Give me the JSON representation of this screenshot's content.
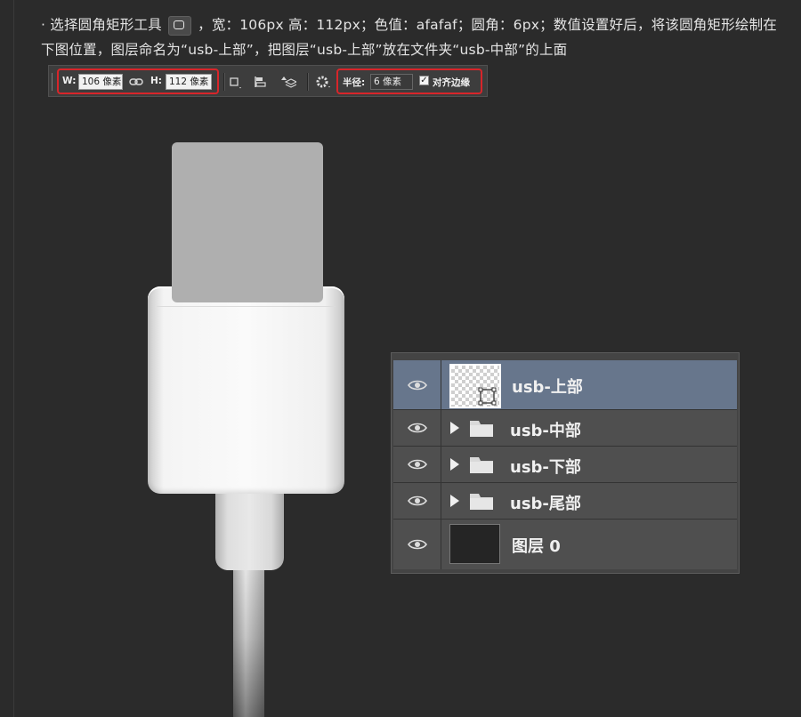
{
  "instruction": {
    "line1_a": "· 选择圆角矩形工具",
    "line1_b": "，宽：106px 高：112px；色值：afafaf；圆角：6px；数值设置好后，将该圆角矩形绘制在",
    "line2": "下图位置，图层命名为“usb-上部”，把图层“usb-上部”放在文件夹“usb-中部”的上面"
  },
  "toolbar": {
    "w_label": "W:",
    "w_value": "106 像素",
    "h_label": "H:",
    "h_value": "112 像素",
    "radius_label": "半径:",
    "radius_value": "6 像素",
    "align_edges_label": "对齐边缘",
    "align_edges_checked": true,
    "highlight_color": "#d8252a"
  },
  "layers": [
    {
      "name": "usb-上部",
      "type": "shape",
      "selected": true,
      "visible": true
    },
    {
      "name": "usb-中部",
      "type": "folder",
      "selected": false,
      "visible": true
    },
    {
      "name": "usb-下部",
      "type": "folder",
      "selected": false,
      "visible": true
    },
    {
      "name": "usb-尾部",
      "type": "folder",
      "selected": false,
      "visible": true
    },
    {
      "name": "图层 0",
      "type": "layer",
      "selected": false,
      "visible": true
    }
  ],
  "colors": {
    "background": "#2b2b2b",
    "shape_fill": "#afafaf",
    "selected_layer": "#67768c"
  }
}
